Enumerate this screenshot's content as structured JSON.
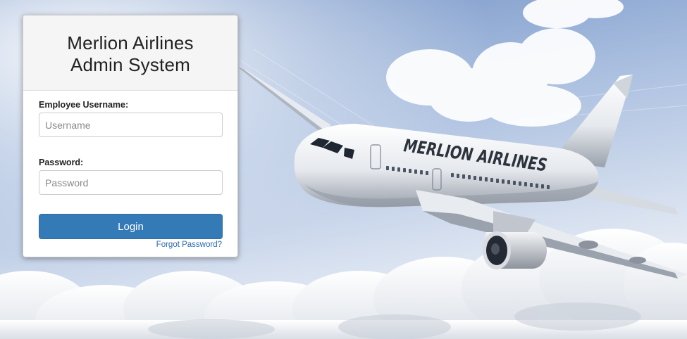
{
  "app": {
    "title_line1": "Merlion Airlines",
    "title_line2": "Admin System",
    "brand_livery": "MERLION AIRLINES"
  },
  "form": {
    "username_label": "Employee Username:",
    "username_placeholder": "Username",
    "username_value": "",
    "password_label": "Password:",
    "password_placeholder": "Password",
    "password_value": "",
    "login_label": "Login",
    "forgot_label": "Forgot Password?"
  },
  "colors": {
    "primary_button": "#337ab7",
    "link": "#2a6bb0",
    "sky_top": "#7c9ccb",
    "sky_bottom": "#eef2f8"
  }
}
